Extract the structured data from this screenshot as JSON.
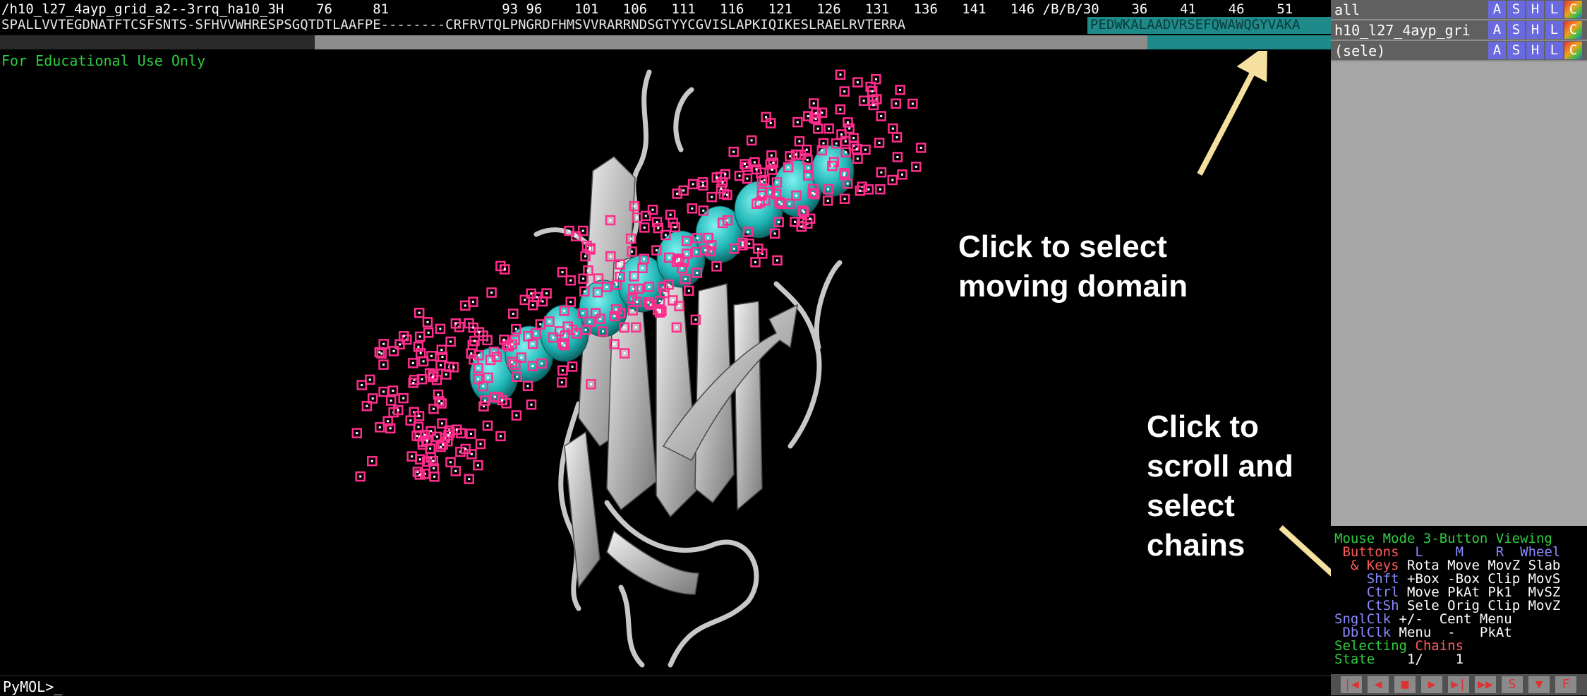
{
  "sequence": {
    "numbers_line": "/h10_l27_4ayp_grid_a2--3rrq_ha10_3H    76     81              93 96    101   106   111   116   121   126   131   136   141   146 /B/B/30    36    41    46    51",
    "residues_line": "SPALLVVTEGDNATFTCSFSNTS-SFHVVWHRESPSGQTDTLAAFPE--------CRFRVTQLPNGRDFHMSVVRARRNDSGTYYCGVISLAPKIQIKESLRAELRVTERRA",
    "residues_chain_b": "PEDWKALAADVRSEFQWAWQGYVAKA"
  },
  "watermark": "For Educational Use Only",
  "callouts": {
    "select_domain": "Click to select moving domain",
    "select_chains": "Click to scroll and select chains"
  },
  "objects": [
    {
      "name": "all",
      "buttons": [
        "A",
        "S",
        "H",
        "L",
        "C"
      ]
    },
    {
      "name": "h10_l27_4ayp_gri",
      "buttons": [
        "A",
        "S",
        "H",
        "L",
        "C"
      ]
    },
    {
      "name": "(sele)",
      "buttons": [
        "A",
        "S",
        "H",
        "L",
        "C"
      ]
    }
  ],
  "mouse_panel": {
    "mode_label": "Mouse Mode",
    "mode_value": "3-Button Viewing",
    "buttons_label": "Buttons",
    "buttons_cols": "L    M    R  Wheel",
    "keys_label": "& Keys",
    "keys_row": "Rota Move MovZ Slab",
    "shft_label": "Shft",
    "shft_row": "+Box -Box Clip MovS",
    "ctrl_label": "Ctrl",
    "ctrl_row": "Move PkAt Pk1  MvSZ",
    "ctsh_label": "CtSh",
    "ctsh_row": "Sele Orig Clip MovZ",
    "snglclk_label": "SnglClk",
    "snglclk_row": "+/-  Cent Menu",
    "dblclk_label": "DblClk",
    "dblclk_row": "Menu  -   PkAt",
    "selecting_label": "Selecting",
    "selecting_value": "Chains",
    "state_label": "State",
    "state_value": "1/    1"
  },
  "transport": [
    "|◀",
    "◀",
    "■",
    "▶",
    "▶|",
    "▶▶",
    "S",
    "▼",
    "F"
  ],
  "command": {
    "prompt": "PyMOL>_"
  },
  "colors": {
    "accent_teal": "#1f8a8a",
    "helix": "#1fb5b5",
    "atoms": "#ff2d8c",
    "arrow": "#f5e0a0"
  }
}
